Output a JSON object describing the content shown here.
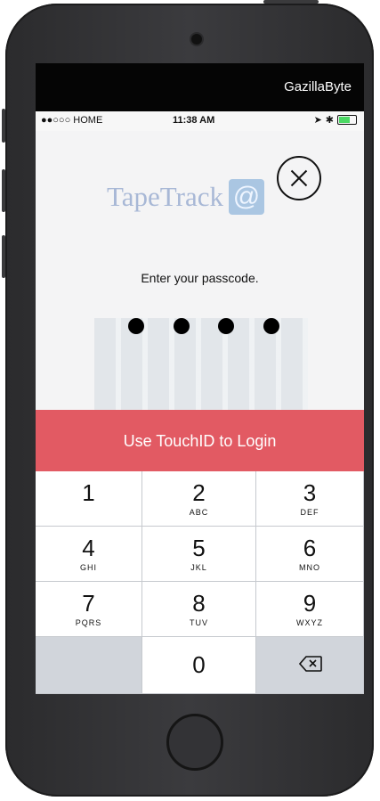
{
  "app": {
    "brand": "GazillaByte",
    "logo_text": "TapeTrack",
    "logo_symbol": "@",
    "prompt": "Enter your passcode.",
    "touch_id_label": "Use TouchID to Login",
    "passcode_entered_count": 4,
    "colors": {
      "touch_id_bar": "#e25a63",
      "top_bar": "#050505",
      "keypad_bg": "#d1d5db"
    }
  },
  "status_bar": {
    "carrier": "●●○○○ HOME",
    "time": "11:38 AM"
  },
  "keypad": {
    "keys": [
      {
        "num": "1",
        "letters": ""
      },
      {
        "num": "2",
        "letters": "ABC"
      },
      {
        "num": "3",
        "letters": "DEF"
      },
      {
        "num": "4",
        "letters": "GHI"
      },
      {
        "num": "5",
        "letters": "JKL"
      },
      {
        "num": "6",
        "letters": "MNO"
      },
      {
        "num": "7",
        "letters": "PQRS"
      },
      {
        "num": "8",
        "letters": "TUV"
      },
      {
        "num": "9",
        "letters": "WXYZ"
      },
      {
        "num": "0",
        "letters": ""
      }
    ]
  }
}
